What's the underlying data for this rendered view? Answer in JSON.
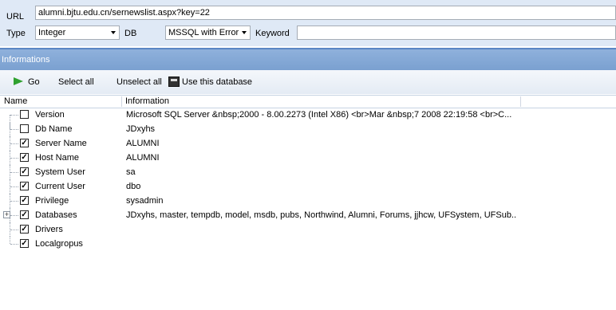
{
  "form": {
    "url_label": "URL",
    "url_value": "alumni.bjtu.edu.cn/sernewslist.aspx?key=22",
    "type_label": "Type",
    "type_value": "Integer",
    "db_label": "DB",
    "db_value": "MSSQL with Error",
    "keyword_label": "Keyword",
    "keyword_value": ""
  },
  "panel": {
    "title": "Informations"
  },
  "toolbar": {
    "go_label": "Go",
    "select_all_label": "Select all",
    "unselect_all_label": "Unselect all",
    "use_db_label": "Use this database"
  },
  "table": {
    "columns": [
      "Name",
      "Information"
    ],
    "rows": [
      {
        "checked": false,
        "name": "Version",
        "info": "Microsoft SQL Server &nbsp;2000 - 8.00.2273 (Intel X86) <br>Mar &nbsp;7 2008 22:19:58 <br>C..."
      },
      {
        "checked": false,
        "name": "Db Name",
        "info": "JDxyhs"
      },
      {
        "checked": true,
        "name": "Server Name",
        "info": "ALUMNI"
      },
      {
        "checked": true,
        "name": "Host Name",
        "info": "ALUMNI"
      },
      {
        "checked": true,
        "name": "System User",
        "info": "sa"
      },
      {
        "checked": true,
        "name": "Current User",
        "info": "dbo"
      },
      {
        "checked": true,
        "name": "Privilege",
        "info": "sysadmin"
      },
      {
        "checked": true,
        "name": "Databases",
        "info": "JDxyhs, master, tempdb, model, msdb, pubs, Northwind, Alumni, Forums, jjhcw, UFSystem, UFSub...",
        "expandable": true
      },
      {
        "checked": true,
        "name": "Drivers",
        "info": ""
      },
      {
        "checked": true,
        "name": "Localgropus",
        "info": ""
      }
    ]
  }
}
